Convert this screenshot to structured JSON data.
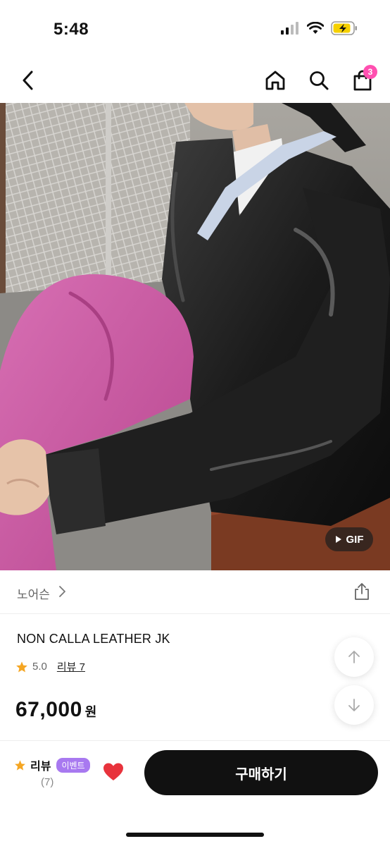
{
  "status_bar": {
    "time": "5:48"
  },
  "nav": {
    "cart_count": "3"
  },
  "product": {
    "gif_label": "GIF",
    "brand": "노어슨",
    "title": "NON CALLA LEATHER JK",
    "rating": "5.0",
    "review_link": "리뷰 7",
    "price": "67,000",
    "price_unit": "원"
  },
  "bottom": {
    "review_label": "리뷰",
    "event_badge": "이벤트",
    "review_count": "(7)",
    "buy_label": "구매하기"
  },
  "colors": {
    "cart_badge": "#ff4fb0",
    "event_badge": "#a879f0",
    "heart": "#e8333c",
    "star": "#f5a623",
    "buy_button": "#111111"
  }
}
